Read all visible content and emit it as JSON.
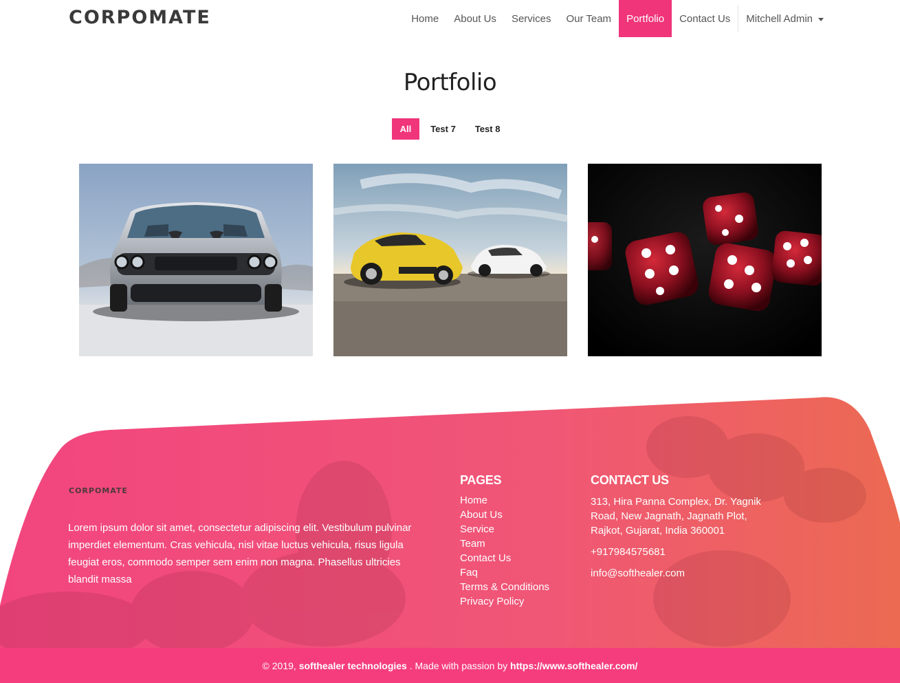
{
  "header": {
    "logo": "CORPOMATE",
    "nav": [
      {
        "label": "Home"
      },
      {
        "label": "About Us"
      },
      {
        "label": "Services"
      },
      {
        "label": "Our Team"
      },
      {
        "label": "Portfolio",
        "active": true
      },
      {
        "label": "Contact Us"
      }
    ],
    "user_menu": "Mitchell Admin"
  },
  "main": {
    "title": "Portfolio",
    "filters": [
      {
        "label": "All",
        "active": true
      },
      {
        "label": "Test 7"
      },
      {
        "label": "Test 8"
      }
    ],
    "gallery": [
      {
        "icon": "silver-muscle-car-image"
      },
      {
        "icon": "yellow-and-white-sports-cars-image"
      },
      {
        "icon": "red-dice-image"
      }
    ]
  },
  "footer": {
    "logo": "CORPOMATE",
    "about": "Lorem ipsum dolor sit amet, consectetur adipiscing elit. Vestibulum pulvinar imperdiet elementum. Cras vehicula, nisl vitae luctus vehicula, risus ligula feugiat eros, commodo semper sem enim non magna. Phasellus ultricies blandit massa",
    "pages_heading": "PAGES",
    "pages": [
      "Home",
      "About Us",
      "Service",
      "Team",
      "Contact Us",
      "Faq",
      "Terms & Conditions",
      "Privacy Policy"
    ],
    "contact_heading": "CONTACT US",
    "address": "313, Hira Panna Complex, Dr. Yagnik Road, New Jagnath, Jagnath Plot, Rajkot, Gujarat, India 360001",
    "phone": "+917984575681",
    "email": "info@softhealer.com",
    "copyright_prefix": "© 2019,",
    "company": "softhealer technologies",
    "made_with": ". Made with passion by",
    "website": "https://www.softhealer.com/"
  },
  "colors": {
    "accent": "#f0357a",
    "footer_gradient_start": "#f2457f",
    "footer_gradient_end": "#ee6a5a"
  }
}
